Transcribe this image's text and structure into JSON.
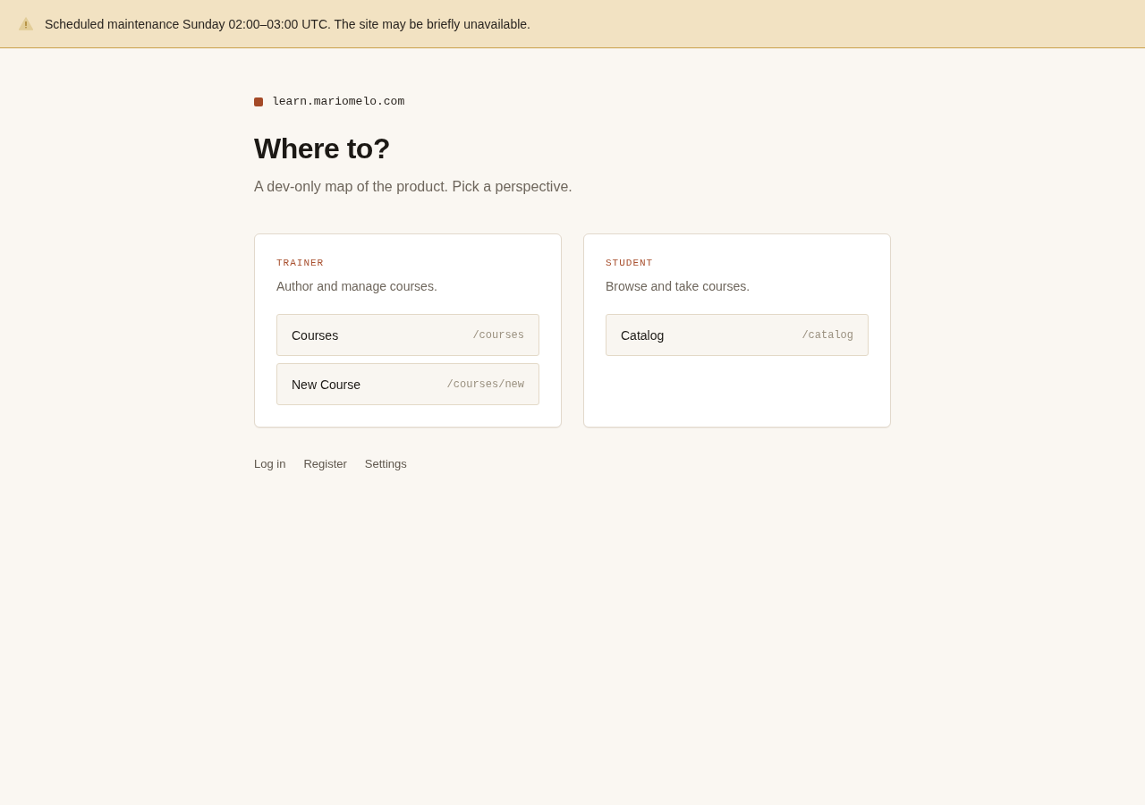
{
  "banner": {
    "message": "Scheduled maintenance Sunday 02:00–03:00 UTC. The site may be briefly unavailable."
  },
  "site": {
    "domain": "learn.mariomelo.com"
  },
  "heading": "Where to?",
  "subtitle": "A dev-only map of the product. Pick a perspective.",
  "perspectives": [
    {
      "label": "TRAINER",
      "description": "Author and manage courses.",
      "links": [
        {
          "title": "Courses",
          "path": "/courses"
        },
        {
          "title": "New Course",
          "path": "/courses/new"
        }
      ]
    },
    {
      "label": "STUDENT",
      "description": "Browse and take courses.",
      "links": [
        {
          "title": "Catalog",
          "path": "/catalog"
        }
      ]
    }
  ],
  "footer_links": [
    "Log in",
    "Register",
    "Settings"
  ]
}
